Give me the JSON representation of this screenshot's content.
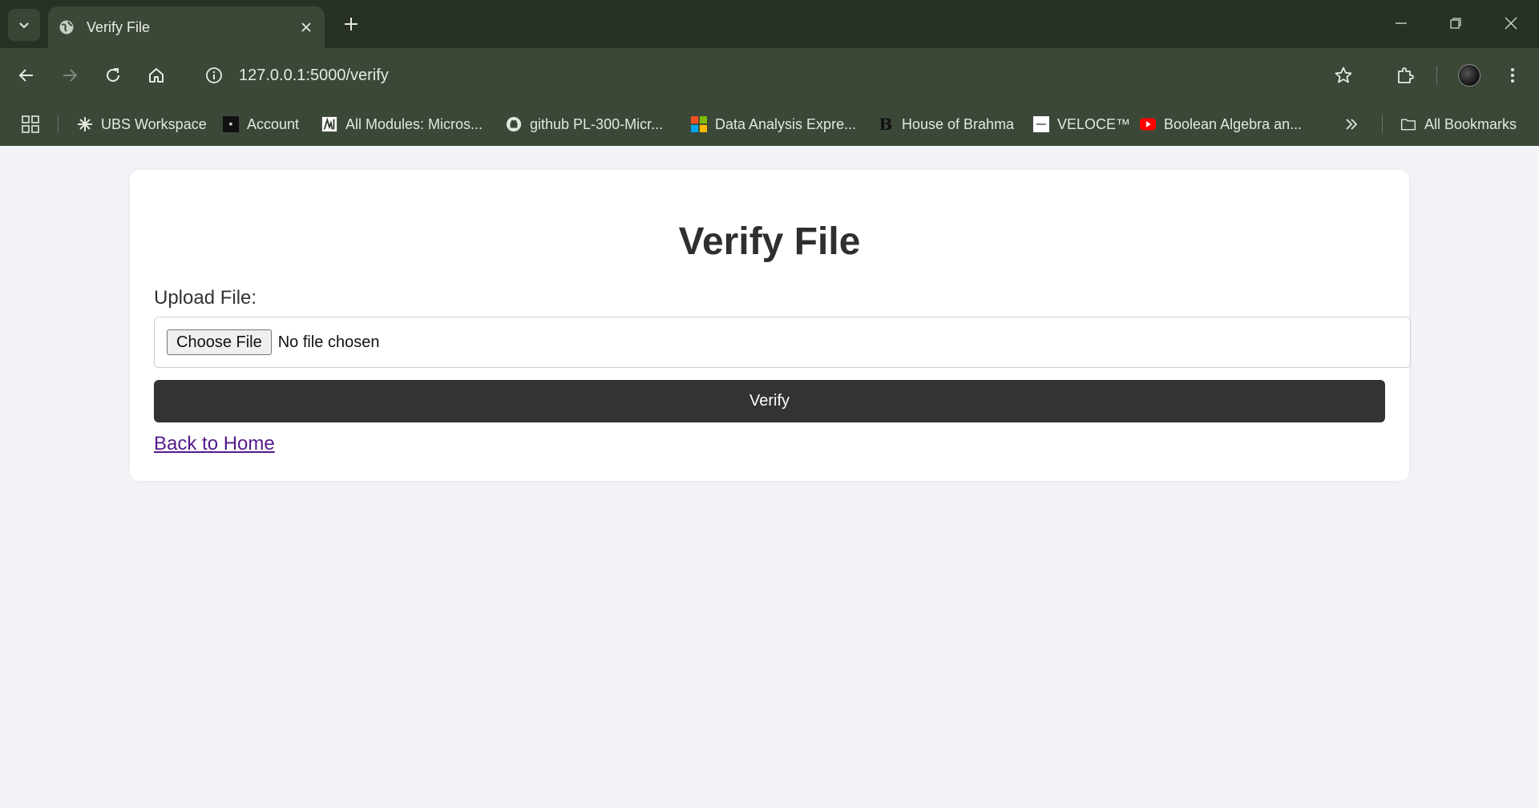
{
  "browser": {
    "tab_title": "Verify File",
    "url": "127.0.0.1:5000/verify",
    "bookmarks": [
      {
        "label": "UBS Workspace",
        "icon": "ubs-icon"
      },
      {
        "label": "Account",
        "icon": "house-of-rare-icon"
      },
      {
        "label": "All Modules: Micros...",
        "icon": "modules-icon"
      },
      {
        "label": "github PL-300-Micr...",
        "icon": "github-icon"
      },
      {
        "label": "Data Analysis Expre...",
        "icon": "microsoft-icon"
      },
      {
        "label": "House of Brahma",
        "icon": "brahma-icon"
      },
      {
        "label": "VELOCE™",
        "icon": "veloce-icon"
      },
      {
        "label": "Boolean Algebra an...",
        "icon": "youtube-icon"
      }
    ],
    "all_bookmarks_label": "All Bookmarks",
    "colors": {
      "tabstrip": "#283126",
      "toolbar": "#3b4838"
    }
  },
  "page": {
    "title": "Verify File",
    "upload_label": "Upload File:",
    "choose_file_label": "Choose File",
    "no_file_text": "No file chosen",
    "verify_label": "Verify",
    "back_link": "Back to Home"
  }
}
